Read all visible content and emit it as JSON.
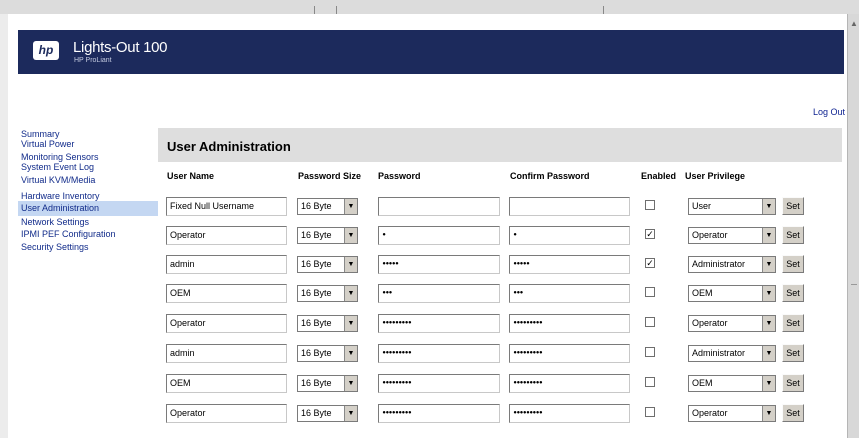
{
  "brand": {
    "title": "Lights-Out 100",
    "subtitle": "HP ProLiant",
    "logo_text": "hp"
  },
  "header": {
    "logout_label": "Log Out"
  },
  "nav": {
    "items": [
      {
        "id": "summary",
        "label": "Summary",
        "active": false
      },
      {
        "id": "virtual-power",
        "label": "Virtual Power",
        "active": false
      },
      {
        "id": "monitoring-sensors",
        "label": "Monitoring Sensors",
        "active": false
      },
      {
        "id": "system-event-log",
        "label": "System Event Log",
        "active": false
      },
      {
        "id": "virtual-kvm-media",
        "label": "Virtual KVM/Media",
        "active": false
      },
      {
        "id": "hardware-inventory",
        "label": "Hardware Inventory",
        "active": false
      },
      {
        "id": "user-administration",
        "label": "User Administration",
        "active": true
      },
      {
        "id": "network-settings",
        "label": "Network Settings",
        "active": false
      },
      {
        "id": "ipmi-pef-configuration",
        "label": "IPMI PEF Configuration",
        "active": false
      },
      {
        "id": "security-settings",
        "label": "Security Settings",
        "active": false
      }
    ]
  },
  "main": {
    "title": "User Administration",
    "columns": {
      "user_name": "User Name",
      "password_size": "Password Size",
      "password": "Password",
      "confirm_password": "Confirm Password",
      "enabled": "Enabled",
      "user_privilege": "User Privilege"
    },
    "set_label": "Set",
    "rows": [
      {
        "user_name": "Fixed Null Username",
        "password_size": "16 Byte",
        "password": "",
        "confirm_password": "",
        "enabled": false,
        "privilege": "User"
      },
      {
        "user_name": "Operator",
        "password_size": "16 Byte",
        "password": "•",
        "confirm_password": "•",
        "enabled": true,
        "privilege": "Operator"
      },
      {
        "user_name": "admin",
        "password_size": "16 Byte",
        "password": "•••••",
        "confirm_password": "•••••",
        "enabled": true,
        "privilege": "Administrator"
      },
      {
        "user_name": "OEM",
        "password_size": "16 Byte",
        "password": "•••",
        "confirm_password": "•••",
        "enabled": false,
        "privilege": "OEM"
      },
      {
        "user_name": "Operator",
        "password_size": "16 Byte",
        "password": "•••••••••",
        "confirm_password": "•••••••••",
        "enabled": false,
        "privilege": "Operator"
      },
      {
        "user_name": "admin",
        "password_size": "16 Byte",
        "password": "•••••••••",
        "confirm_password": "•••••••••",
        "enabled": false,
        "privilege": "Administrator"
      },
      {
        "user_name": "OEM",
        "password_size": "16 Byte",
        "password": "•••••••••",
        "confirm_password": "•••••••••",
        "enabled": false,
        "privilege": "OEM"
      },
      {
        "user_name": "Operator",
        "password_size": "16 Byte",
        "password": "•••••••••",
        "confirm_password": "•••••••••",
        "enabled": false,
        "privilege": "Operator"
      }
    ]
  },
  "icons": {
    "dropdown": "chevron-down-icon",
    "check": "checkmark-icon"
  }
}
